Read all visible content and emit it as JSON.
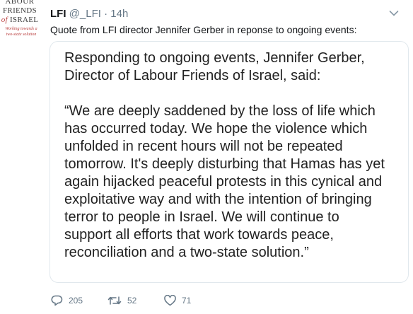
{
  "avatar": {
    "line1": "ABOUR",
    "line2": "FRIENDS",
    "line3_of": "of",
    "line3_rest": "ISRAEL",
    "tagline": "Working towards a two-state solution"
  },
  "tweet": {
    "name": "LFI",
    "handle": "@_LFI",
    "separator": "·",
    "time": "14h",
    "text": "Quote from LFI director Jennifer Gerber in reponse to ongoing events:"
  },
  "card": {
    "intro_lines": [
      "Responding to ongoing events, Jennifer Gerber,",
      "Director of Labour Friends of Israel, said:"
    ],
    "quote_lines": [
      "“We are deeply saddened by the loss of life which",
      "has occurred today. We hope the violence which",
      "unfolded in recent hours will not be repeated",
      "tomorrow. It's deeply disturbing that Hamas has yet",
      "again hijacked peaceful protests in this cynical and",
      "exploitative way and with the intention of bringing",
      "terror to people in Israel. We will continue to",
      "support all efforts that work towards peace,",
      "reconciliation and a two-state solution.”"
    ]
  },
  "actions": {
    "reply_count": "205",
    "retweet_count": "52",
    "like_count": "71",
    "retweet_color": "#17bf63",
    "icon_color": "#657786"
  }
}
